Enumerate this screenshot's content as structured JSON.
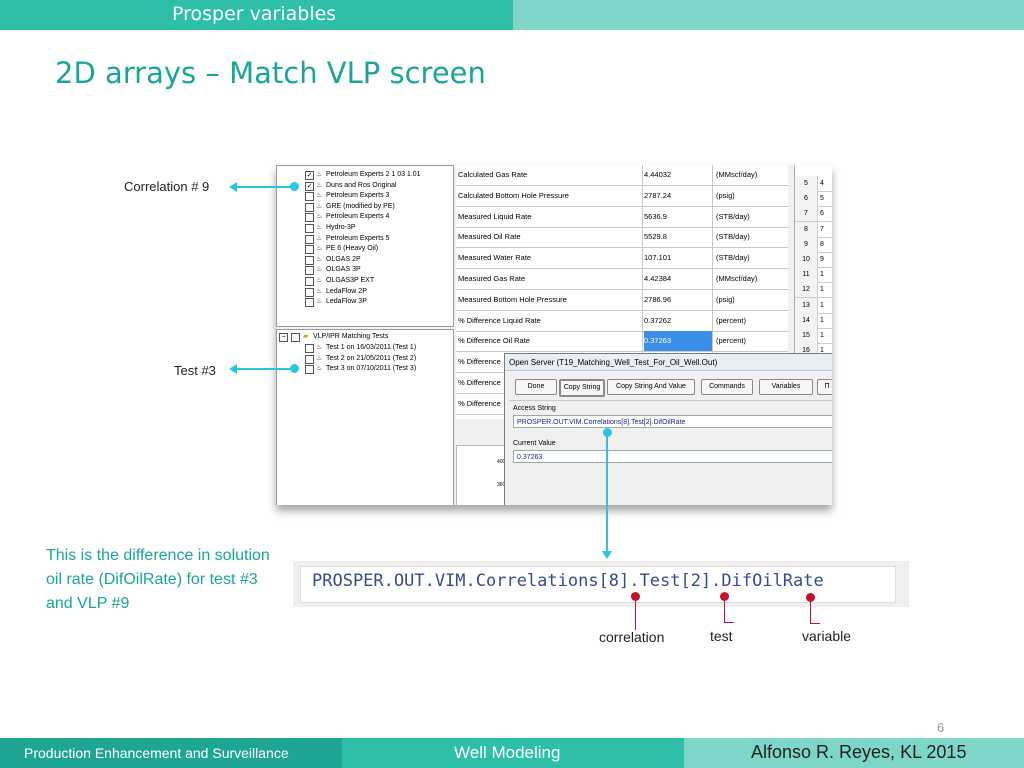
{
  "header": {
    "section_title": "Prosper variables"
  },
  "slide": {
    "title": "2D arrays – Match VLP screen",
    "page_number": "6"
  },
  "correlations": [
    {
      "label": "Petroleum Experts 2 1 03 1.01",
      "checked": true
    },
    {
      "label": "Duns and Ros Original",
      "checked": true
    },
    {
      "label": "Petroleum Experts 3",
      "checked": false
    },
    {
      "label": "GRE (modified by PE)",
      "checked": false
    },
    {
      "label": "Petroleum Experts 4",
      "checked": false
    },
    {
      "label": "Hydro-3P",
      "checked": false
    },
    {
      "label": "Petroleum Experts 5",
      "checked": false
    },
    {
      "label": "PE 6 (Heavy Oil)",
      "checked": false
    },
    {
      "label": "OLGAS 2P",
      "checked": false
    },
    {
      "label": "OLGAS 3P",
      "checked": false
    },
    {
      "label": "OLGAS3P EXT",
      "checked": false
    },
    {
      "label": "LedaFlow 2P",
      "checked": false
    },
    {
      "label": "LedaFlow 3P",
      "checked": false
    }
  ],
  "tests_tree": {
    "root": "VLP/IPR Matching Tests",
    "items": [
      "Test 1 on 16/03/2011 (Test 1)",
      "Test 2 on 21/05/2011 (Test 2)",
      "Test 3 on 07/10/2011 (Test 3)"
    ]
  },
  "grid_rows": [
    {
      "name": "Calculated Gas Rate",
      "value": "4.44032",
      "unit": "(MMscf/day)"
    },
    {
      "name": "Calculated Bottom Hole Pressure",
      "value": "2787.24",
      "unit": "(psig)"
    },
    {
      "name": "Measured Liquid Rate",
      "value": "5636.9",
      "unit": "(STB/day)"
    },
    {
      "name": "Measured Oil Rate",
      "value": "5529.8",
      "unit": "(STB/day)"
    },
    {
      "name": "Measured Water Rate",
      "value": "107.101",
      "unit": "(STB/day)"
    },
    {
      "name": "Measured Gas Rate",
      "value": "4.42384",
      "unit": "(MMscf/day)"
    },
    {
      "name": "Measured Bottom Hole Pressure",
      "value": "2786.96",
      "unit": "(psig)"
    },
    {
      "name": "% Difference Liquid Rate",
      "value": "0.37262",
      "unit": "(percent)"
    },
    {
      "name": "% Difference Oil Rate",
      "value": "0.37263",
      "unit": "(percent)"
    },
    {
      "name": "% Difference",
      "value": "",
      "unit": ""
    },
    {
      "name": "% Difference",
      "value": "",
      "unit": ""
    },
    {
      "name": "% Difference",
      "value": "",
      "unit": ""
    }
  ],
  "right_grid": [
    {
      "a": "5",
      "b": "4"
    },
    {
      "a": "6",
      "b": "5"
    },
    {
      "a": "7",
      "b": "6"
    },
    {
      "a": "8",
      "b": "7"
    },
    {
      "a": "9",
      "b": "8"
    },
    {
      "a": "10",
      "b": "9"
    },
    {
      "a": "11",
      "b": "1"
    },
    {
      "a": "12",
      "b": "1"
    },
    {
      "a": "13",
      "b": "1"
    },
    {
      "a": "14",
      "b": "1"
    },
    {
      "a": "15",
      "b": "1"
    },
    {
      "a": "16",
      "b": "1"
    }
  ],
  "plot": {
    "tick_1": "400",
    "tick_2": "3600"
  },
  "dialog": {
    "title": "Open Server (T19_Matching_Well_Test_For_Oil_Well.Out)",
    "buttons": [
      "Done",
      "Copy String",
      "Copy String And Value",
      "Commands",
      "Variables",
      "Π"
    ],
    "access_label": "Access String",
    "access_value": "PROSPER.OUT.VIM.Correlations[8].Test[2].DifOilRate",
    "current_label": "Current Value",
    "current_value": "0.37263"
  },
  "labels": {
    "correlation": "Correlation # 9",
    "test": "Test #3"
  },
  "note": "This is the difference in solution oil rate (DifOilRate) for test #3 and VLP #9",
  "code": "PROSPER.OUT.VIM.Correlations[8].Test[2].DifOilRate",
  "annotations": {
    "correlation": "correlation",
    "test": "test",
    "variable": "variable"
  },
  "footer": {
    "left": "Production Enhancement and Surveillance",
    "center": "Well Modeling",
    "right": "Alfonso R. Reyes, KL 2015"
  },
  "colors": {
    "teal_dark": "#1fa594",
    "teal": "#2ebfa8",
    "teal_light": "#7dd6c8",
    "arrow": "#28c6e0",
    "marker": "#c4122e",
    "selected": "#3a8ee6"
  }
}
